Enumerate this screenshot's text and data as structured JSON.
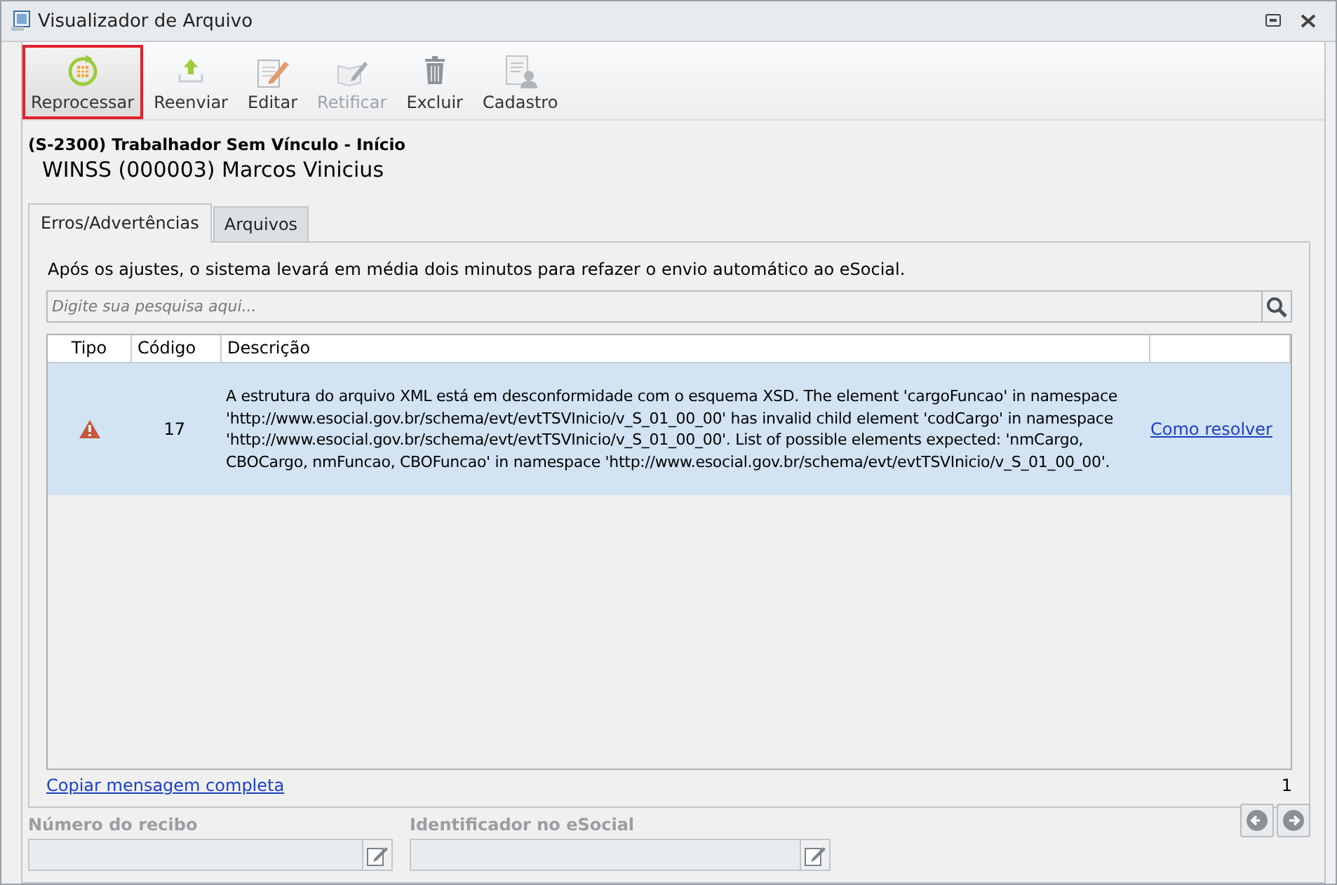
{
  "window": {
    "title": "Visualizador de Arquivo"
  },
  "toolbar": [
    {
      "label": "Reprocessar",
      "kind": "reprocess",
      "selected": true,
      "disabled": false
    },
    {
      "label": "Reenviar",
      "kind": "upload",
      "selected": false,
      "disabled": false
    },
    {
      "label": "Editar",
      "kind": "edit",
      "selected": false,
      "disabled": false
    },
    {
      "label": "Retificar",
      "kind": "rectify",
      "selected": false,
      "disabled": true
    },
    {
      "label": "Excluir",
      "kind": "delete",
      "selected": false,
      "disabled": false
    },
    {
      "label": "Cadastro",
      "kind": "register",
      "selected": false,
      "disabled": false
    }
  ],
  "event": {
    "title": "(S-2300) Trabalhador Sem Vínculo - Início",
    "subject": "WINSS (000003) Marcos Vinicius"
  },
  "tabs": [
    {
      "label": "Erros/Advertências",
      "selected": true
    },
    {
      "label": "Arquivos",
      "selected": false
    }
  ],
  "notice": "Após os ajustes, o sistema levará em média dois minutos para refazer o envio automático ao eSocial.",
  "search": {
    "placeholder": "Digite sua pesquisa aqui..."
  },
  "table": {
    "columns": [
      "Tipo",
      "Código",
      "Descrição"
    ],
    "rows": [
      {
        "kind": "error",
        "code": "17",
        "description": "A estrutura do arquivo XML está em desconformidade com o esquema XSD. The element 'cargoFuncao' in namespace 'http://www.esocial.gov.br/schema/evt/evtTSVInicio/v_S_01_00_00' has invalid child element 'codCargo' in namespace 'http://www.esocial.gov.br/schema/evt/evtTSVInicio/v_S_01_00_00'. List of possible elements expected: 'nmCargo, CBOCargo, nmFuncao, CBOFuncao' in namespace 'http://www.esocial.gov.br/schema/evt/evtTSVInicio/v_S_01_00_00'.",
        "action": "Como resolver",
        "selected": true
      }
    ]
  },
  "copy_link": "Copiar mensagem completa",
  "count": "1",
  "fields": [
    {
      "label": "Número do recibo",
      "disabled": true
    },
    {
      "label": "Identificador no eSocial",
      "disabled": true
    }
  ]
}
